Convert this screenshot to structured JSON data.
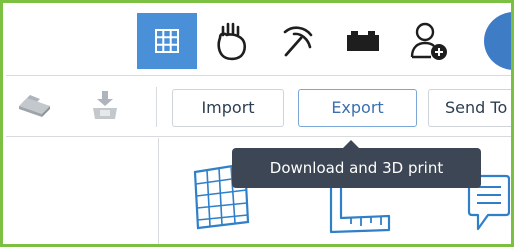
{
  "nav": {
    "items": [
      {
        "icon": "grid-icon",
        "active": true
      },
      {
        "icon": "hand-icon",
        "active": false
      },
      {
        "icon": "pickaxe-icon",
        "active": false
      },
      {
        "icon": "brick-icon",
        "active": false
      },
      {
        "icon": "add-user-icon",
        "active": false
      }
    ],
    "avatar_color": "#3f7cc6"
  },
  "toolbar": {
    "import_label": "Import",
    "export_label": "Export",
    "send_label": "Send To"
  },
  "tooltip": {
    "text": "Download and 3D print"
  },
  "colors": {
    "frame_border": "#7bc043",
    "active_nav": "#4a90d9",
    "icon_blue": "#2f80c9",
    "tooltip_bg": "#3d4654"
  },
  "canvas_icons": [
    "grid-plane-icon",
    "ruler-icon",
    "note-icon"
  ]
}
